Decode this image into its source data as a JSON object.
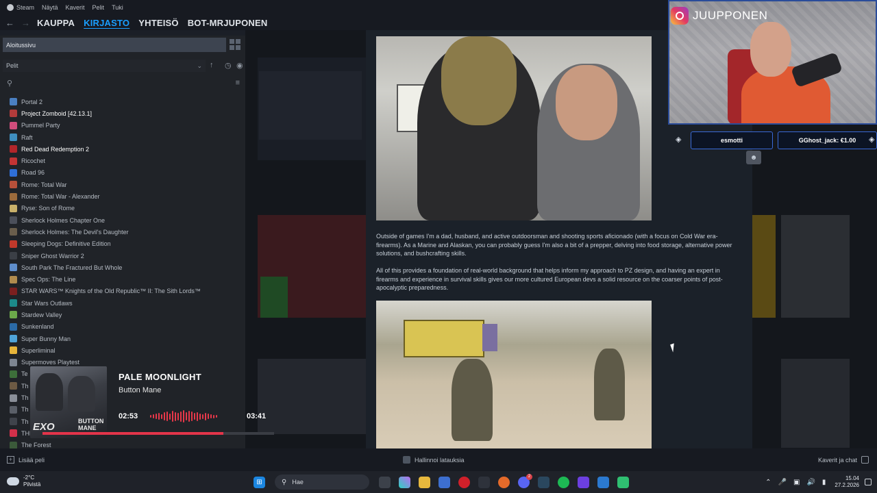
{
  "menu": {
    "items": [
      "Steam",
      "Näytä",
      "Kaverit",
      "Pelit",
      "Tuki"
    ]
  },
  "nav": {
    "links": [
      "KAUPPA",
      "KIRJASTO",
      "YHTEISÖ",
      "BOT-MRJUPONEN"
    ],
    "active": "KIRJASTO"
  },
  "sidebar": {
    "home_label": "Aloitussivu",
    "filter_label": "Pelit",
    "games": [
      {
        "name": "Portal 2",
        "bold": false,
        "color": "#4a7fc1"
      },
      {
        "name": "Project Zomboid [42.13.1]",
        "bold": true,
        "color": "#b23b3b"
      },
      {
        "name": "Pummel Party",
        "bold": false,
        "color": "#d04d7c"
      },
      {
        "name": "Raft",
        "bold": false,
        "color": "#3f8fbf"
      },
      {
        "name": "Red Dead Redemption 2",
        "bold": true,
        "color": "#b2262a"
      },
      {
        "name": "Ricochet",
        "bold": false,
        "color": "#c23434"
      },
      {
        "name": "Road 96",
        "bold": false,
        "color": "#2f6fd8"
      },
      {
        "name": "Rome: Total War",
        "bold": false,
        "color": "#b8503a"
      },
      {
        "name": "Rome: Total War - Alexander",
        "bold": false,
        "color": "#9c6b3c"
      },
      {
        "name": "Ryse: Son of Rome",
        "bold": false,
        "color": "#c8b06a"
      },
      {
        "name": "Sherlock Holmes Chapter One",
        "bold": false,
        "color": "#4b4f5a"
      },
      {
        "name": "Sherlock Holmes: The Devil's Daughter",
        "bold": false,
        "color": "#6a5e4c"
      },
      {
        "name": "Sleeping Dogs: Definitive Edition",
        "bold": false,
        "color": "#c1392b"
      },
      {
        "name": "Sniper Ghost Warrior 2",
        "bold": false,
        "color": "#3b3f46"
      },
      {
        "name": "South Park The Fractured But Whole",
        "bold": false,
        "color": "#5f8ecb"
      },
      {
        "name": "Spec Ops: The Line",
        "bold": false,
        "color": "#b08b4e"
      },
      {
        "name": "STAR WARS™ Knights of the Old Republic™ II: The Sith Lords™",
        "bold": false,
        "color": "#7b1f1f"
      },
      {
        "name": "Star Wars Outlaws",
        "bold": false,
        "color": "#1c8a8a"
      },
      {
        "name": "Stardew Valley",
        "bold": false,
        "color": "#6ba84a"
      },
      {
        "name": "Sunkenland",
        "bold": false,
        "color": "#2b6aa6"
      },
      {
        "name": "Super Bunny Man",
        "bold": false,
        "color": "#4fa3d8"
      },
      {
        "name": "Superliminal",
        "bold": false,
        "color": "#e6b43a"
      },
      {
        "name": "Supermoves Playtest",
        "bold": false,
        "color": "#7d8591"
      },
      {
        "name": "Te",
        "bold": false,
        "color": "#3d6f3a"
      },
      {
        "name": "Th",
        "bold": false,
        "color": "#6c5a44"
      },
      {
        "name": "Th",
        "bold": false,
        "color": "#8a8f98"
      },
      {
        "name": "Th",
        "bold": false,
        "color": "#5a5f68"
      },
      {
        "name": "Th",
        "bold": false,
        "color": "#3f434b"
      },
      {
        "name": "THE FINALS",
        "bold": false,
        "color": "#d2304a"
      },
      {
        "name": "The Forest",
        "bold": false,
        "color": "#3b5a3a"
      }
    ]
  },
  "now_playing": {
    "title": "PALE MOONLIGHT",
    "artist": "Button Mane",
    "elapsed": "02:53",
    "total": "03:41",
    "progress": 0.78,
    "art_logo": "EXO",
    "art_logo2": "BUTTON MANE",
    "accent": "#e3344a"
  },
  "article": {
    "para1": "Outside of games I'm a dad, husband, and active outdoorsman and shooting sports aficionado (with a focus on Cold War era-firearms). As a Marine and Alaskan, you can probably guess I'm also a bit of a prepper, delving into food storage, alternative power solutions, and bushcrafting skills.",
    "para2": "All of this provides a foundation of real-world background that helps inform my approach to PZ design, and having an expert in firearms and experience in survival skills gives our more cultured European devs a solid resource on the coarser points of post-apocalyptic preparedness."
  },
  "stream": {
    "instagram_name": "JUUPPONEN",
    "donors": [
      "esmotti",
      "GGhost_jack: €1.00"
    ]
  },
  "bottombar": {
    "add_game": "Lisää peli",
    "downloads": "Hallinnoi latauksia",
    "friends": "Kaverit ja chat"
  },
  "taskbar": {
    "temperature": "-2°C",
    "weather": "Pilvistä",
    "search_placeholder": "Hae",
    "time": "15.04",
    "date": "27.2.2026",
    "discord_badge": "2"
  }
}
